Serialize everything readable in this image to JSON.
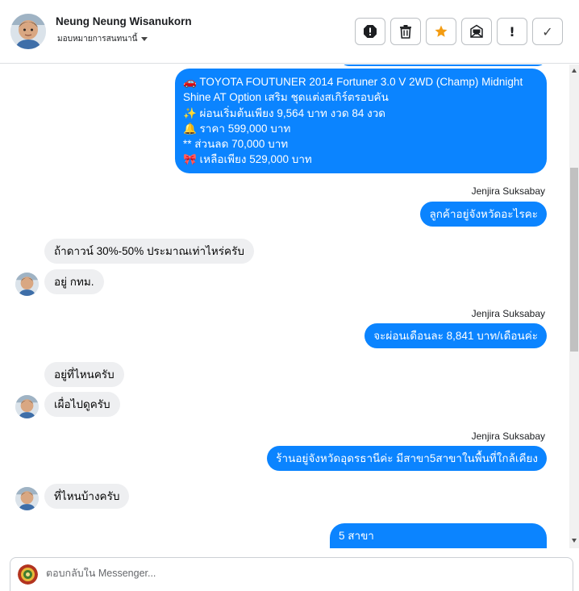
{
  "header": {
    "contact_name": "Neung Neung Wisanukorn",
    "assign_label": "มอบหมายการสนทนานี้",
    "actions": {
      "spam_icon": "!",
      "done_icon": "✓"
    }
  },
  "thread": {
    "messages": [
      {
        "lines": [
          "🚗 TOYOTA FOUTUNER 2014 Fortuner 3.0 V 2WD (Champ) Midnight",
          "Shine AT  Option เสริม ชุดแต่งสเกิร์ตรอบคัน",
          "✨ ผ่อนเริ่มต้นเพียง 9,564 บาท งวด 84 งวด",
          "🔔 ราคา 599,000 บาท",
          "** ส่วนลด 70,000 บาท",
          "🎀 เหลือเพียง 529,000 บาท"
        ]
      },
      {
        "sender": "Jenjira Suksabay",
        "text": "ลูกค้าอยู่จังหวัดอะไรคะ"
      },
      {
        "text": "ถ้าดาวน์ 30%-50%  ประมาณเท่าไหร่ครับ"
      },
      {
        "text": "อยู่ กทม."
      },
      {
        "sender": "Jenjira Suksabay",
        "text": "จะผ่อนเดือนละ 8,841 บาท/เดือนค่ะ"
      },
      {
        "text": "อยู่ที่ไหนครับ"
      },
      {
        "text": "เผื่อไปดูครับ"
      },
      {
        "sender": "Jenjira Suksabay",
        "text": "ร้านอยู่จังหวัดอุดรธานีค่ะ มีสาขา5สาขาในพื้นที่ใกล้เคียง"
      },
      {
        "text": "ที่ไหนบ้างครับ"
      },
      {
        "text": "5 สาขา"
      }
    ]
  },
  "composer": {
    "placeholder": "ตอบกลับใน Messenger..."
  },
  "colors": {
    "outgoing_bubble": "#0b84ff",
    "incoming_bubble": "#eeeff1",
    "star_icon": "#f39c12"
  }
}
